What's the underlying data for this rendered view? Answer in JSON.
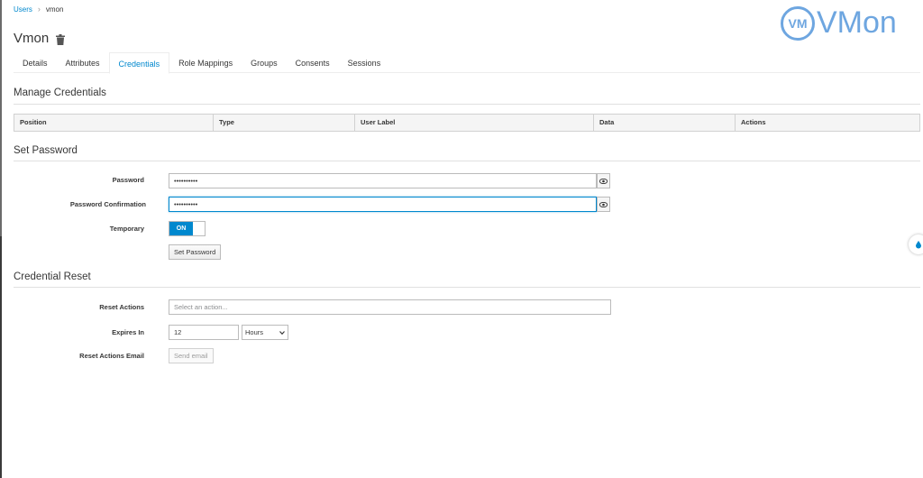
{
  "breadcrumb": {
    "parent": "Users",
    "current": "vmon"
  },
  "page": {
    "title": "Vmon"
  },
  "logo": {
    "mark": "VM",
    "text": "VMon"
  },
  "tabs": [
    "Details",
    "Attributes",
    "Credentials",
    "Role Mappings",
    "Groups",
    "Consents",
    "Sessions"
  ],
  "manage": {
    "title": "Manage Credentials",
    "columns": [
      "Position",
      "Type",
      "User Label",
      "Data",
      "Actions"
    ]
  },
  "set_password": {
    "title": "Set Password",
    "password_label": "Password",
    "password_value": "••••••••••",
    "confirm_label": "Password Confirmation",
    "confirm_value": "••••••••••",
    "temporary_label": "Temporary",
    "temporary_state": "ON",
    "button": "Set Password"
  },
  "reset": {
    "title": "Credential Reset",
    "actions_label": "Reset Actions",
    "actions_placeholder": "Select an action...",
    "expires_label": "Expires In",
    "expires_value": "12",
    "expires_unit": "Hours",
    "email_label": "Reset Actions Email",
    "email_button": "Send email"
  },
  "colors": {
    "accent": "#0088ce",
    "logo": "#6ea6e0"
  }
}
